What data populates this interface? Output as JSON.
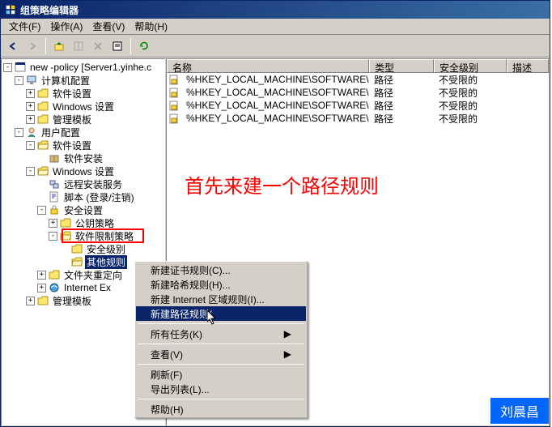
{
  "title": "组策略编辑器",
  "menu": {
    "file": "文件(F)",
    "action": "操作(A)",
    "view": "查看(V)",
    "help": "帮助(H)"
  },
  "tree": {
    "root": "new -policy [Server1.yinhe.c",
    "computer_cfg": "计算机配置",
    "sw_settings": "软件设置",
    "win_settings": "Windows 设置",
    "admin_tmpl": "管理模板",
    "user_cfg": "用户配置",
    "sw_install": "软件安装",
    "remote_install": "远程安装服务",
    "scripts": "脚本 (登录/注销)",
    "sec_settings": "安全设置",
    "pubkey": "公钥策略",
    "sw_restrict": "软件限制策略",
    "sec_level": "安全级别",
    "other_rules": "其他规则",
    "folder_redir": "文件夹重定向",
    "ie_maint": "Internet Ex"
  },
  "columns": {
    "name": "名称",
    "type": "类型",
    "level": "安全级别",
    "desc": "描述"
  },
  "rows": [
    {
      "name": "%HKEY_LOCAL_MACHINE\\SOFTWARE\\Micro...",
      "type": "路径",
      "level": "不受限的"
    },
    {
      "name": "%HKEY_LOCAL_MACHINE\\SOFTWARE\\Micro...",
      "type": "路径",
      "level": "不受限的"
    },
    {
      "name": "%HKEY_LOCAL_MACHINE\\SOFTWARE\\Micro...",
      "type": "路径",
      "level": "不受限的"
    },
    {
      "name": "%HKEY_LOCAL_MACHINE\\SOFTWARE\\Micro...",
      "type": "路径",
      "level": "不受限的"
    }
  ],
  "context": {
    "new_cert": "新建证书规则(C)...",
    "new_hash": "新建哈希规则(H)...",
    "new_zone": "新建 Internet 区域规则(I)...",
    "new_path": "新建路径规则(",
    "all_tasks": "所有任务(K)",
    "view": "查看(V)",
    "refresh": "刷新(F)",
    "export": "导出列表(L)...",
    "help": "帮助(H)"
  },
  "annotation": "首先来建一个路径规则",
  "name_tag": "刘晨昌"
}
